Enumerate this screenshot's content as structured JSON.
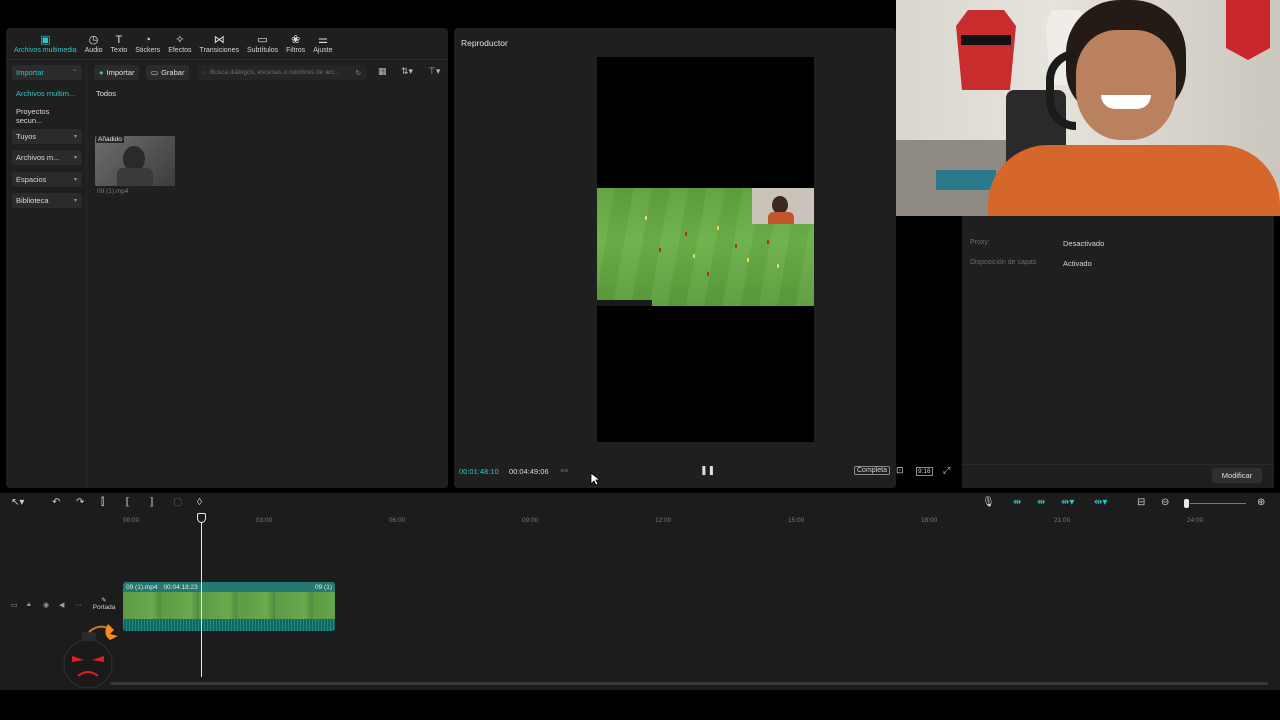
{
  "media_toolbar": {
    "tabs": [
      {
        "icon": "media-icon",
        "label": "Archivos multimedia"
      },
      {
        "icon": "audio-icon",
        "label": "Audio"
      },
      {
        "icon": "text-icon",
        "label": "Texto"
      },
      {
        "icon": "sticker-icon",
        "label": "Stickers"
      },
      {
        "icon": "effects-icon",
        "label": "Efectos"
      },
      {
        "icon": "transition-icon",
        "label": "Transiciones"
      },
      {
        "icon": "subtitles-icon",
        "label": "Subtítulos"
      },
      {
        "icon": "filter-icon",
        "label": "Filtros"
      },
      {
        "icon": "adjust-icon",
        "label": "Ajuste"
      }
    ]
  },
  "media_sidebar": {
    "items": [
      {
        "label": "Importar"
      },
      {
        "label": "Archivos multim..."
      },
      {
        "label": "Proyectos secun..."
      },
      {
        "label": "Tuyos"
      },
      {
        "label": "Archivos m..."
      },
      {
        "label": "Espacios"
      },
      {
        "label": "Biblioteca"
      }
    ]
  },
  "media_content": {
    "import_label": "Importar",
    "record_label": "Grabar",
    "search_placeholder": "Busca diálogos, escenas o nombres de arc...",
    "filter_label": "Todos",
    "clip": {
      "badge": "Añadido",
      "filename": "09 (1).mp4"
    }
  },
  "player": {
    "title": "Reproductor",
    "time_current": "00:01:48:10",
    "time_total": "00:04:49:06",
    "complete_label": "Completa",
    "ratio_label": "9:16"
  },
  "properties": {
    "rows": [
      {
        "label": "Proxy:",
        "value": "Desactivado"
      },
      {
        "label": "Disposición de capas",
        "value": "Activado"
      }
    ],
    "modify_label": "Modificar"
  },
  "timeline": {
    "ticks": [
      "00:00",
      "03:00",
      "06:00",
      "09:00",
      "12:00",
      "15:00",
      "18:00",
      "21:00",
      "24:00"
    ],
    "clip": {
      "name": "09 (1).mp4",
      "duration": "00:04:18:23",
      "tail_name": "09 (1)"
    },
    "cover_label": "Portada"
  },
  "colors": {
    "accent": "#2ec4c9",
    "panel": "#1f1f1f",
    "clip": "#1f6b63"
  }
}
